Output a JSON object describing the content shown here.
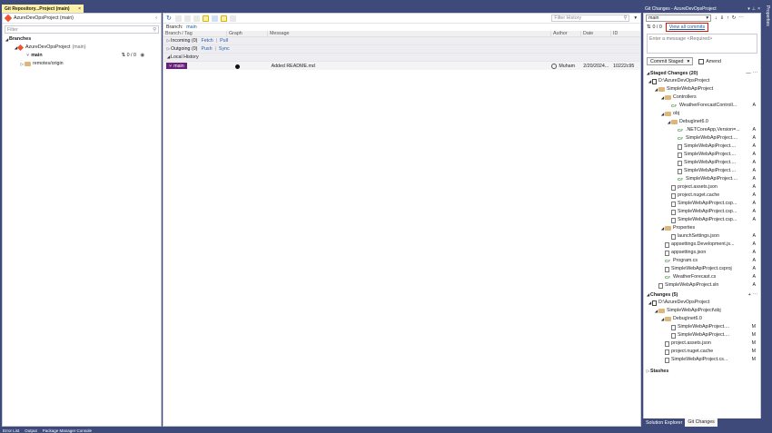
{
  "document_tab": {
    "title": "Git Repository...Project (main)",
    "close": "×"
  },
  "repo_pane": {
    "repo_name": "AzureDevOpsProject (main)",
    "filter_placeholder": "Filter",
    "branches_header": "Branches",
    "project": "AzureDevOpsProject",
    "project_suffix": "(main)",
    "branch_main": "main",
    "branch_status": "0 / 0",
    "remotes": "remotes/origin"
  },
  "history_pane": {
    "filter_placeholder": "Filter History",
    "branch_label": "Branch:",
    "branch_value": "main",
    "columns": [
      "Branch / Tag",
      "Graph",
      "Message",
      "Author",
      "Date",
      "ID"
    ],
    "incoming": "Incoming (0)",
    "incoming_actions": [
      "Fetch",
      "Pull"
    ],
    "outgoing": "Outgoing (0)",
    "outgoing_actions": [
      "Push",
      "Sync"
    ],
    "local_history": "Local History",
    "commits": [
      {
        "tag": "main",
        "message": "Added README.md",
        "author": "Muham",
        "date": "2/20/2024...",
        "id": "10222c95"
      }
    ]
  },
  "git_changes": {
    "title": "Git Changes - AzureDevOpsProject",
    "branch": "main",
    "counts": "0 / 0",
    "view_all_commits": "View all commits",
    "message_placeholder": "Enter a message <Required>",
    "commit_button": "Commit Staged",
    "amend": "Amend",
    "staged_header": "Staged Changes (20)",
    "staged": [
      {
        "label": "D:\\AzureDevOpsProject",
        "indent": 0,
        "kind": "repo",
        "status": ""
      },
      {
        "label": "SimpleWebApiProject",
        "indent": 1,
        "kind": "folder",
        "status": ""
      },
      {
        "label": "Controllers",
        "indent": 2,
        "kind": "folder",
        "status": ""
      },
      {
        "label": "WeatherForecastControll...",
        "indent": 3,
        "kind": "cs",
        "status": "A"
      },
      {
        "label": "obj",
        "indent": 2,
        "kind": "folder",
        "status": ""
      },
      {
        "label": "Debug\\net6.0",
        "indent": 3,
        "kind": "folder",
        "status": ""
      },
      {
        "label": ".NETCoreApp,Version=...",
        "indent": 4,
        "kind": "cs",
        "status": "A"
      },
      {
        "label": "SimpleWebApiProject....",
        "indent": 4,
        "kind": "cs",
        "status": "A"
      },
      {
        "label": "SimpleWebApiProject....",
        "indent": 4,
        "kind": "file",
        "status": "A"
      },
      {
        "label": "SimpleWebApiProject....",
        "indent": 4,
        "kind": "file",
        "status": "A"
      },
      {
        "label": "SimpleWebApiProject....",
        "indent": 4,
        "kind": "file",
        "status": "A"
      },
      {
        "label": "SimpleWebApiProject....",
        "indent": 4,
        "kind": "file",
        "status": "A"
      },
      {
        "label": "SimpleWebApiProject....",
        "indent": 4,
        "kind": "cs",
        "status": "A"
      },
      {
        "label": "project.assets.json",
        "indent": 3,
        "kind": "file",
        "status": "A"
      },
      {
        "label": "project.nuget.cache",
        "indent": 3,
        "kind": "file",
        "status": "A"
      },
      {
        "label": "SimpleWebApiProject.csp...",
        "indent": 3,
        "kind": "file",
        "status": "A"
      },
      {
        "label": "SimpleWebApiProject.csp...",
        "indent": 3,
        "kind": "file",
        "status": "A"
      },
      {
        "label": "SimpleWebApiProject.csp...",
        "indent": 3,
        "kind": "file",
        "status": "A"
      },
      {
        "label": "Properties",
        "indent": 2,
        "kind": "folder",
        "status": ""
      },
      {
        "label": "launchSettings.json",
        "indent": 3,
        "kind": "file",
        "status": "A"
      },
      {
        "label": "appsettings.Development.js...",
        "indent": 2,
        "kind": "file",
        "status": "A"
      },
      {
        "label": "appsettings.json",
        "indent": 2,
        "kind": "file",
        "status": "A"
      },
      {
        "label": "Program.cs",
        "indent": 2,
        "kind": "cs",
        "status": "A"
      },
      {
        "label": "SimpleWebApiProject.csproj",
        "indent": 2,
        "kind": "file",
        "status": "A"
      },
      {
        "label": "WeatherForecast.cs",
        "indent": 2,
        "kind": "cs",
        "status": "A"
      },
      {
        "label": "SimpleWebApiProject.sln",
        "indent": 1,
        "kind": "file",
        "status": "A"
      }
    ],
    "changes_header": "Changes (5)",
    "changes": [
      {
        "label": "D:\\AzureDevOpsProject",
        "indent": 0,
        "kind": "repo",
        "status": ""
      },
      {
        "label": "SimpleWebApiProject\\obj",
        "indent": 1,
        "kind": "folder",
        "status": ""
      },
      {
        "label": "Debug\\net6.0",
        "indent": 2,
        "kind": "folder",
        "status": ""
      },
      {
        "label": "SimpleWebApiProject....",
        "indent": 3,
        "kind": "file",
        "status": "M"
      },
      {
        "label": "SimpleWebApiProject....",
        "indent": 3,
        "kind": "file",
        "status": "M"
      },
      {
        "label": "project.assets.json",
        "indent": 2,
        "kind": "file",
        "status": "M"
      },
      {
        "label": "project.nuget.cache",
        "indent": 2,
        "kind": "file",
        "status": "M"
      },
      {
        "label": "SimpleWebApiProject.cs...",
        "indent": 2,
        "kind": "file",
        "status": "M"
      }
    ],
    "stashes": "Stashes",
    "bottom_tabs": [
      "Solution Explorer",
      "Git Changes"
    ]
  },
  "right_strip": "Properties",
  "status_bar": [
    "Error List",
    "Output",
    "Package Manager Console"
  ],
  "colors": {
    "accent_purple": "#68217a",
    "highlight_box": "#e51400",
    "link": "#1f5ea8"
  }
}
